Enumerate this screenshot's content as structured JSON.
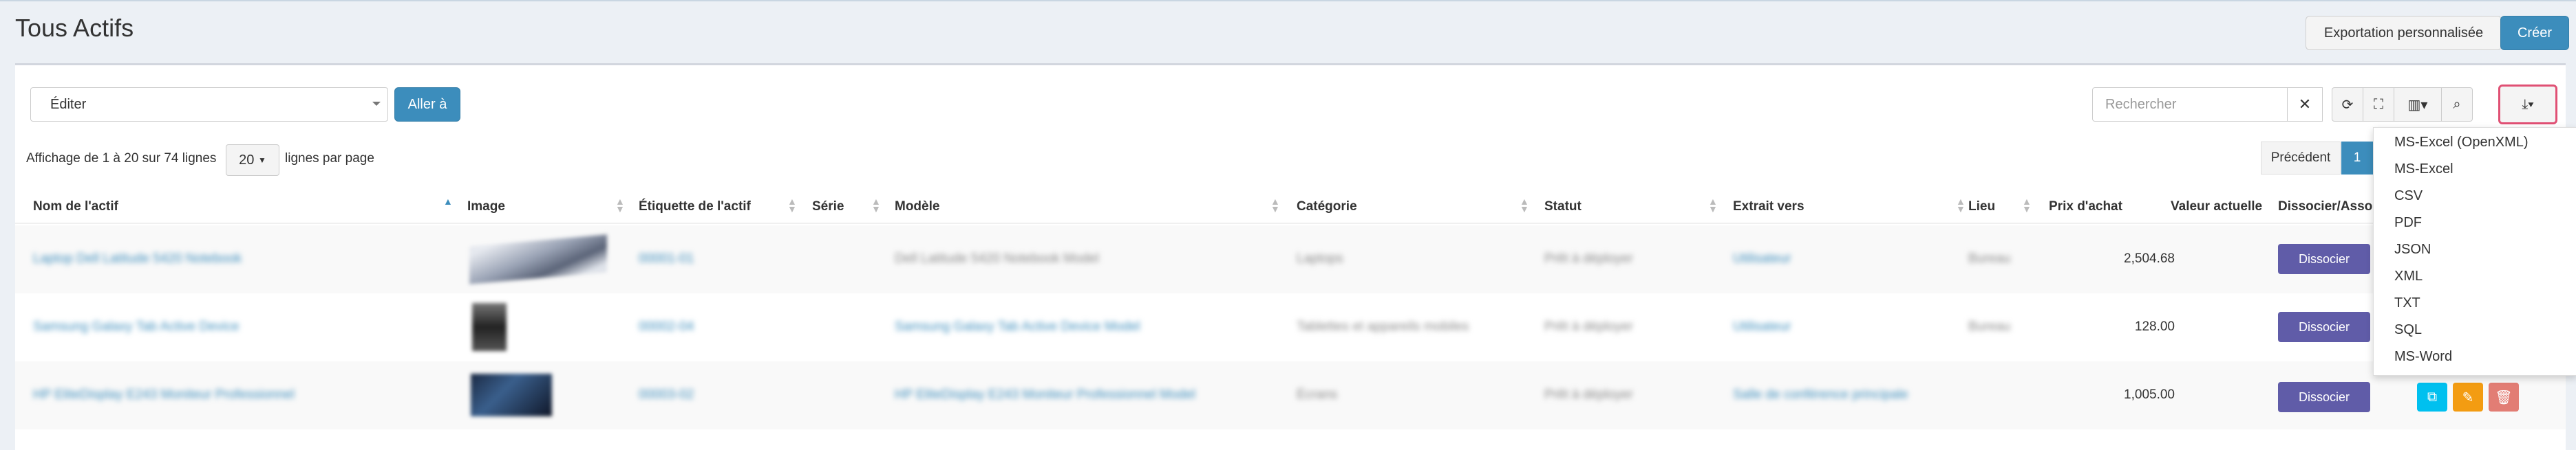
{
  "header": {
    "title": "Tous Actifs",
    "export_label": "Exportation personnalisée",
    "create_label": "Créer"
  },
  "toolbar": {
    "bulk_select_value": "Éditer",
    "goto_label": "Aller à",
    "search_placeholder": "Rechercher",
    "clear_glyph": "✕",
    "refresh_glyph": "⟳",
    "fullscreen_glyph": "⛶",
    "columns_glyph": "▥▾",
    "advanced_search_glyph": "⌕",
    "download_glyph": "⤓▾",
    "icons": [
      "close-icon",
      "refresh-icon",
      "fullscreen-icon",
      "columns-icon",
      "advanced-search-icon",
      "download-icon"
    ]
  },
  "pagination": {
    "showing_text": "Affichage de 1 à 20 sur 74 lignes",
    "page_size": "20",
    "per_page_text": "lignes par page",
    "prev_label": "Précédent",
    "current_page": "1"
  },
  "columns": [
    "Nom de l'actif",
    "Image",
    "Étiquette de l'actif",
    "Série",
    "Modèle",
    "Catégorie",
    "Statut",
    "Extrait vers",
    "Lieu",
    "Prix d'achat",
    "Valeur actuelle",
    "Dissocier/Associer"
  ],
  "rows": [
    {
      "name": "Laptop Dell Latitude 5420 Notebook",
      "tag": "00001-01",
      "model": "Dell Latitude 5420 Notebook Model",
      "category": "Laptops",
      "status": "Prêt à déployer",
      "checked_out": "Utilisateur",
      "location": "Bureau",
      "price": "2,504.68",
      "action": "Dissocier"
    },
    {
      "name": "Samsung Galaxy Tab Active Device",
      "tag": "00002-04",
      "model": "Samsung Galaxy Tab Active Device Model",
      "category": "Tablettes et appareils mobiles",
      "status": "Prêt à déployer",
      "checked_out": "Utilisateur",
      "location": "Bureau",
      "price": "128.00",
      "action": "Dissocier"
    },
    {
      "name": "HP EliteDisplay E243 Moniteur Professionnel",
      "tag": "00003-02",
      "model": "HP EliteDisplay E243 Moniteur Professionnel Model",
      "category": "Écrans",
      "status": "Prêt à déployer",
      "checked_out": "Salle de conférence principale",
      "location": "",
      "price": "1,005.00",
      "action": "Dissocier"
    }
  ],
  "export_menu": [
    "MS-Excel (OpenXML)",
    "MS-Excel",
    "CSV",
    "PDF",
    "JSON",
    "XML",
    "TXT",
    "SQL",
    "MS-Word"
  ],
  "row_actions": {
    "clone_glyph": "⧉",
    "edit_glyph": "✎",
    "delete_glyph": "🗑",
    "icons": [
      "clone-icon",
      "edit-icon",
      "delete-icon"
    ]
  },
  "colors": {
    "primary": "#3c8dbc",
    "dissocier": "#605ca8",
    "clone": "#00c0ef",
    "edit": "#f39c12",
    "delete": "#e27d74",
    "highlight_border": "#e05074"
  }
}
